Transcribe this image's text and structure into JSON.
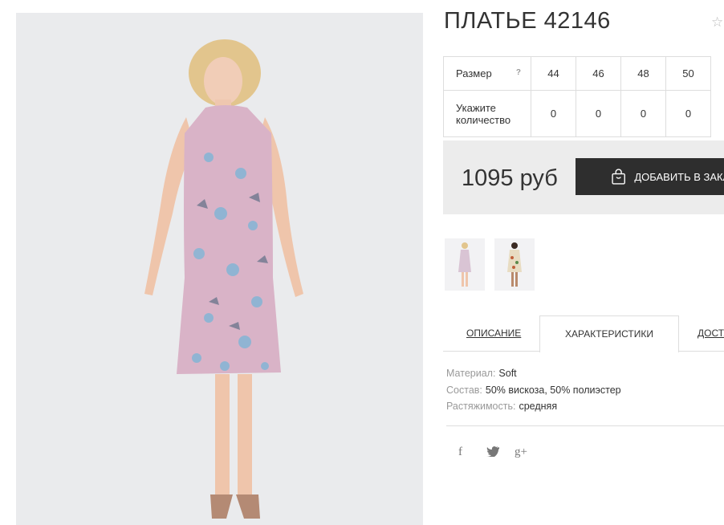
{
  "product": {
    "title": "ПЛАТЬЕ 42146",
    "favorite_icon": "star-outline-icon"
  },
  "sizes": {
    "row_label": "Размер",
    "help": "?",
    "values": [
      "44",
      "46",
      "48",
      "50"
    ],
    "qty_label_line1": "Укажите",
    "qty_label_line2": "количество",
    "quantities": [
      "0",
      "0",
      "0",
      "0"
    ]
  },
  "purchase": {
    "price": "1095 руб",
    "add_button": "ДОБАВИТЬ В ЗАКАЗ"
  },
  "tabs": [
    {
      "label": "ОПИСАНИЕ"
    },
    {
      "label": "ХАРАКТЕРИСТИКИ",
      "active": true
    },
    {
      "label": "ДОСТАВКА"
    }
  ],
  "properties": [
    {
      "key": "Материал:",
      "value": "Soft"
    },
    {
      "key": "Состав:",
      "value": "50% вискоза, 50% полиэстер"
    },
    {
      "key": "Растяжимость:",
      "value": "средняя"
    }
  ],
  "social": [
    {
      "glyph": "f",
      "icon": "facebook-icon"
    },
    {
      "glyph": "t",
      "icon": "twitter-icon"
    },
    {
      "glyph": "g+",
      "icon": "google-plus-icon"
    }
  ],
  "colors": {
    "button_bg": "#2e2e2e",
    "price_bg": "#ececec",
    "dress": "#d9b3c7"
  }
}
